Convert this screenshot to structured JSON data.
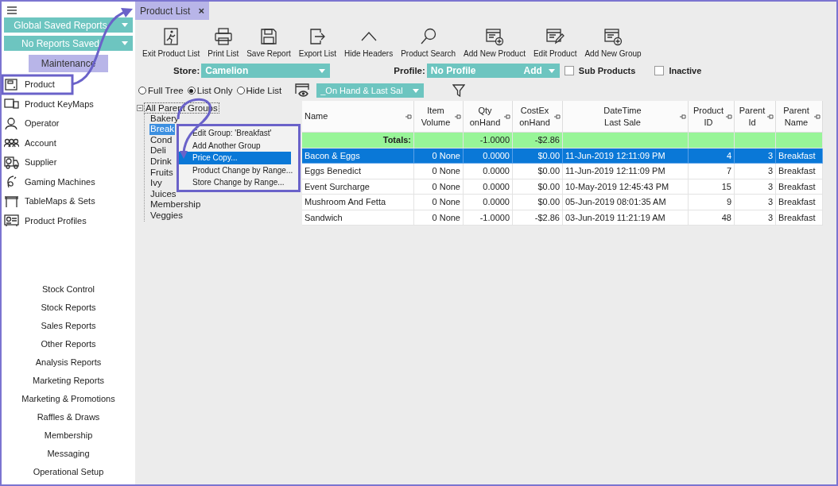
{
  "saved_reports": [
    {
      "label": "Global Saved Reports"
    },
    {
      "label": "No Reports Saved"
    }
  ],
  "section_tab": "Maintenance",
  "nav_items": [
    {
      "label": "Product"
    },
    {
      "label": "Product KeyMaps"
    },
    {
      "label": "Operator"
    },
    {
      "label": "Account"
    },
    {
      "label": "Supplier"
    },
    {
      "label": "Gaming Machines"
    },
    {
      "label": "TableMaps & Sets"
    },
    {
      "label": "Product Profiles"
    }
  ],
  "report_sections": [
    "Stock Control",
    "Stock Reports",
    "Sales Reports",
    "Other Reports",
    "Analysis Reports",
    "Marketing Reports",
    "Marketing & Promotions",
    "Raffles & Draws",
    "Membership",
    "Messaging",
    "Operational Setup"
  ],
  "tabs": [
    {
      "label": "Product List",
      "close": "×",
      "selected": true
    }
  ],
  "toolbar": [
    "Exit Product List",
    "Print List",
    "Save Report",
    "Export List",
    "Hide Headers",
    "Product Search",
    "Add New Product",
    "Edit Product",
    "Add New Group"
  ],
  "filters": {
    "store_label": "Store:",
    "store": "Camelion",
    "profile_label": "Profile:",
    "profile": "No Profile",
    "profile_add": "Add",
    "checkboxes": [
      {
        "label": "Sub Products",
        "checked": false
      },
      {
        "label": "Inactive",
        "checked": false
      }
    ]
  },
  "view_options": [
    {
      "label": "Full Tree",
      "selected": false
    },
    {
      "label": "List Only",
      "selected": true
    },
    {
      "label": "Hide List",
      "selected": false
    }
  ],
  "layout": "_On Hand & Last Sal",
  "tree": {
    "label": "All Parent Groups",
    "expanded": true,
    "children": [
      {
        "label": "Bakery",
        "selected": false
      },
      {
        "label": "Break",
        "selected": true
      },
      {
        "label": "Cond",
        "selected": false
      },
      {
        "label": "Deli",
        "selected": false
      },
      {
        "label": "Drink",
        "selected": false
      },
      {
        "label": "Fruits",
        "selected": false
      },
      {
        "label": "Ivy",
        "selected": false
      },
      {
        "label": "Juices",
        "selected": false
      },
      {
        "label": "Membership",
        "selected": false
      },
      {
        "label": "Veggies",
        "selected": false
      }
    ]
  },
  "context_menu": [
    {
      "label": "Edit Group: 'Breakfast'",
      "selected": false
    },
    {
      "label": "Add Another Group",
      "selected": false
    },
    {
      "label": "Price Copy...",
      "selected": true
    },
    {
      "label": "Product Change by Range...",
      "selected": false
    },
    {
      "label": "Store Change by Range...",
      "selected": false
    }
  ],
  "table": {
    "columns": [
      {
        "label": "Name"
      },
      {
        "label": "Item\nVolume"
      },
      {
        "label": "Qty\nonHand"
      },
      {
        "label": "CostEx\nonHand"
      },
      {
        "label": "DateTime\nLast Sale"
      },
      {
        "label": "Product\nID"
      },
      {
        "label": "Parent\nId"
      },
      {
        "label": "Parent\nName"
      }
    ],
    "totals": {
      "label": "Totals:",
      "qty_on_hand": "-1.0000",
      "costex_on_hand": "-$2.86"
    },
    "rows": [
      {
        "cells": [
          "Bacon & Eggs",
          "0 None",
          "0.0000",
          "$0.00",
          "11-Jun-2019 12:11:09 PM",
          "4",
          "3",
          "Breakfast"
        ],
        "selected": true
      },
      {
        "cells": [
          "Eggs Benedict",
          "0 None",
          "0.0000",
          "$0.00",
          "11-Jun-2019 12:11:09 PM",
          "7",
          "3",
          "Breakfast"
        ],
        "selected": false
      },
      {
        "cells": [
          "Event Surcharge",
          "0 None",
          "0.0000",
          "$0.00",
          "10-May-2019 12:45:43 PM",
          "15",
          "3",
          "Breakfast"
        ],
        "selected": false
      },
      {
        "cells": [
          "Mushroom And Fetta",
          "0 None",
          "0.0000",
          "$0.00",
          "05-Jun-2019 08:01:35 AM",
          "9",
          "3",
          "Breakfast"
        ],
        "selected": false
      },
      {
        "cells": [
          "Sandwich",
          "0 None",
          "-1.0000",
          "-$2.86",
          "03-Jun-2019 11:21:19 AM",
          "48",
          "3",
          "Breakfast"
        ],
        "selected": false
      }
    ]
  }
}
